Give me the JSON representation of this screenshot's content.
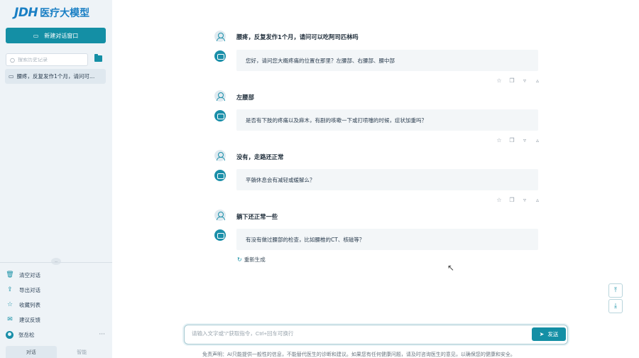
{
  "sidebar": {
    "logo_brand": "JDH",
    "logo_text": "医疗大模型",
    "new_chat_label": "新建对话窗口",
    "search_placeholder": "搜索历史记录",
    "history": [
      {
        "label": "腰疼，反复发作1个月，请问可…"
      }
    ],
    "menu": [
      {
        "label": "清空对话",
        "icon": "trash-icon"
      },
      {
        "label": "导出对话",
        "icon": "export-icon"
      },
      {
        "label": "收藏列表",
        "icon": "star-icon"
      },
      {
        "label": "建议反馈",
        "icon": "mail-icon"
      }
    ],
    "user_name": "张岳松",
    "more": "···",
    "tabs": [
      {
        "label": "对话",
        "active": true
      },
      {
        "label": "智能"
      }
    ]
  },
  "chat": {
    "messages": [
      {
        "question": "腰疼，反复发作1个月，请问可以吃阿司匹林吗",
        "answer": "您好，请问您大概疼痛的位置在那里？左腰部、右腰部、腰中部"
      },
      {
        "question": "左腰部",
        "answer": "是否有下肢的疼痛以及麻木，有剧的咳嗽一下或打喷嚏的时候，症状加重吗？"
      },
      {
        "question": "没有，走路还正常",
        "answer": "平躺休息会有减轻或缓解么？"
      },
      {
        "question": "躺下还正常一些",
        "answer": "有没有做过腰部的检查，比如腰椎的CT、核磁等？"
      }
    ],
    "regenerate_label": "重新生成"
  },
  "input": {
    "placeholder": "请输入文字或\"/\"获取指令，Ctrl+回车可换行",
    "send_label": "发送"
  },
  "disclaimer": "免责声明：AI只能提供一般性的信息，不能替代医生的诊断和建议。如果您有任何健康问题，请及时咨询医生的意见，以确保您的健康和安全。",
  "colors": {
    "accent": "#148fa5",
    "brand": "#1a7fc4"
  }
}
